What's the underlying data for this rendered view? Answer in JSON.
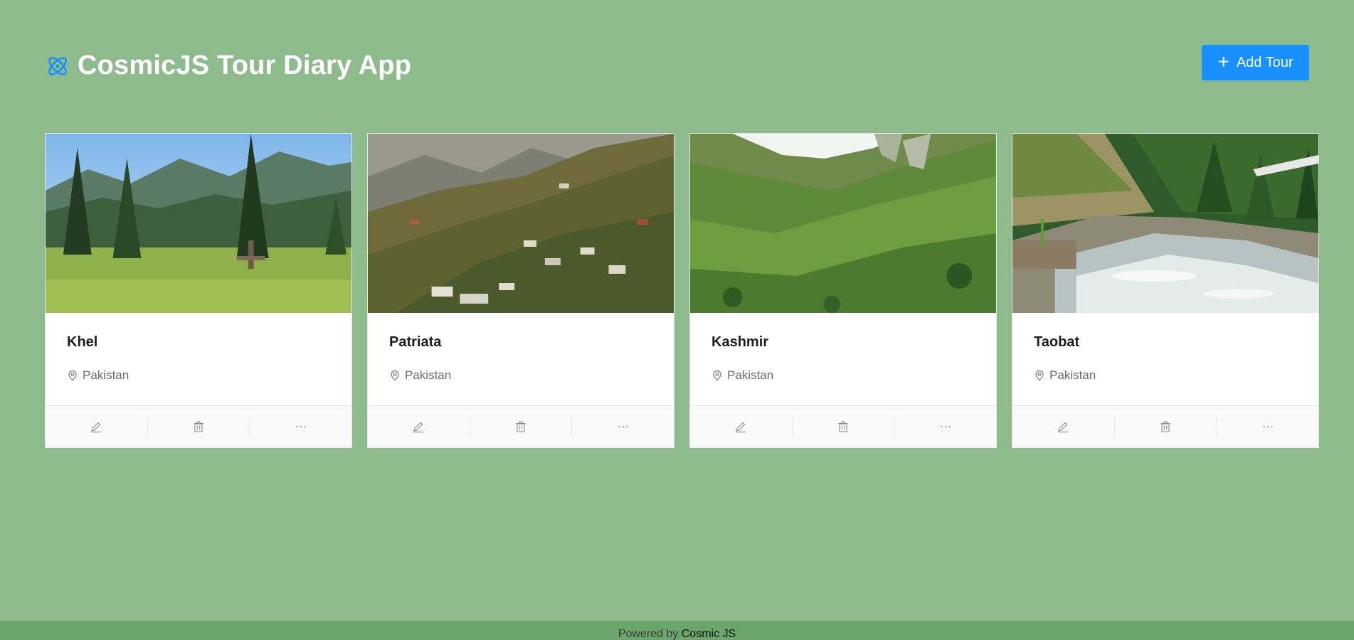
{
  "app": {
    "title": "CosmicJS Tour Diary App",
    "add_button_label": "Add Tour",
    "accent": "#1890ff",
    "background": "#8dbb8c"
  },
  "tours": [
    {
      "title": "Khel",
      "location": "Pakistan"
    },
    {
      "title": "Patriata",
      "location": "Pakistan"
    },
    {
      "title": "Kashmir",
      "location": "Pakistan"
    },
    {
      "title": "Taobat",
      "location": "Pakistan"
    }
  ],
  "card_actions": [
    "edit-icon",
    "delete-icon",
    "more-icon"
  ],
  "footer": {
    "prefix": "Powered by",
    "link": "Cosmic JS"
  }
}
